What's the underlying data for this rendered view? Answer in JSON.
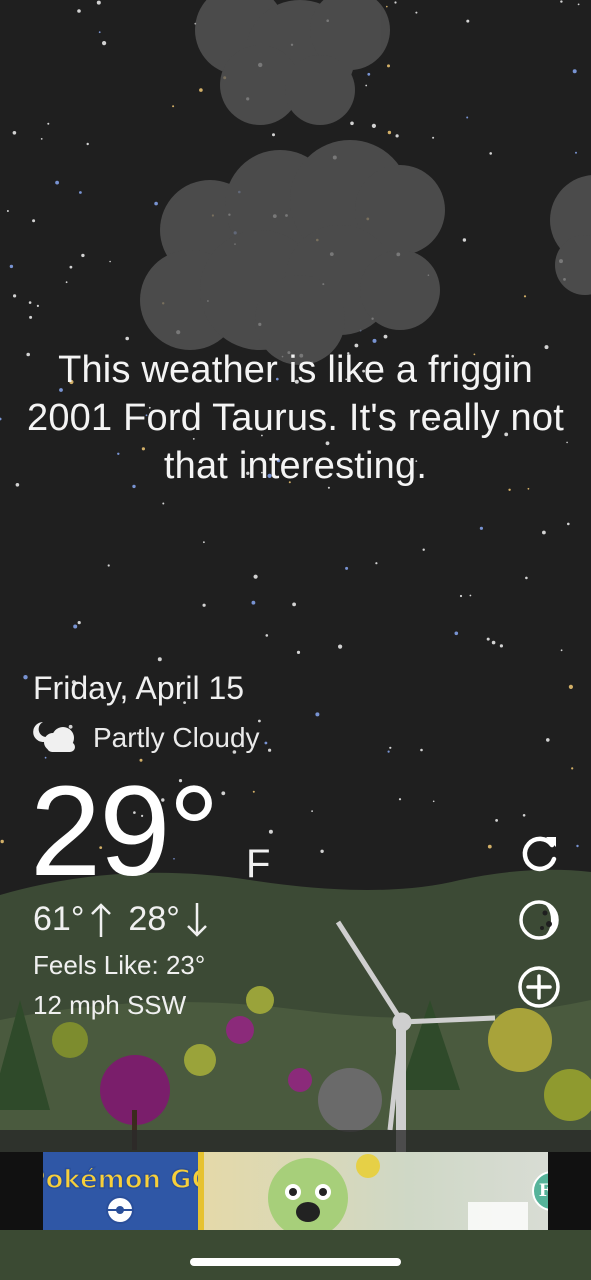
{
  "quote": "This weather is like a friggin 2001 Ford Taurus. It's really not that interesting.",
  "date": "Friday, April 15",
  "condition": {
    "icon": "moon-cloud-icon",
    "text": "Partly Cloudy"
  },
  "temperature": {
    "value": "29°",
    "unit": "F"
  },
  "high_low": {
    "high": "61°",
    "high_icon": "arrow-up-icon",
    "low": "28°",
    "low_icon": "arrow-down-icon"
  },
  "feels_like": "Feels Like: 23°",
  "wind": "12 mph SSW",
  "actions": [
    {
      "name": "refresh",
      "icon": "refresh-icon"
    },
    {
      "name": "theme",
      "icon": "moon-circle-icon"
    },
    {
      "name": "add-location",
      "icon": "plus-circle-icon"
    }
  ],
  "ad": {
    "brand": "Pokémon GO",
    "cta": "FREE INSTALL"
  },
  "colors": {
    "sky": "#1f1f1f",
    "hill": "#4a5a3e",
    "ad_button": "#56b39a"
  }
}
